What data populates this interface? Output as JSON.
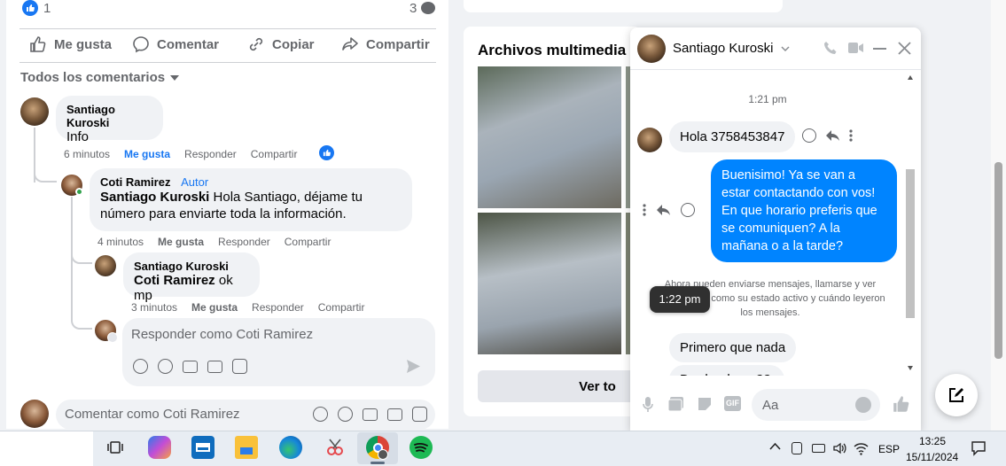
{
  "post": {
    "like_count": "1",
    "comment_count": "3",
    "actions": {
      "like": "Me gusta",
      "comment": "Comentar",
      "copy": "Copiar",
      "share": "Compartir"
    },
    "comments_filter": "Todos los comentarios"
  },
  "comments": {
    "c1": {
      "author": "Santiago Kuroski",
      "text": "Info",
      "time": "6 minutos",
      "like": "Me gusta",
      "reply": "Responder",
      "share": "Compartir"
    },
    "c2": {
      "author": "Coti Ramirez",
      "badge": "Autor",
      "mention": "Santiago Kuroski",
      "text": " Hola Santiago, déjame tu número para enviarte toda la información.",
      "time": "4 minutos",
      "like": "Me gusta",
      "reply": "Responder",
      "share": "Compartir"
    },
    "c3": {
      "author": "Santiago Kuroski",
      "mention": "Coti Ramirez",
      "text": " ok mp",
      "time": "3 minutos",
      "like": "Me gusta",
      "reply": "Responder",
      "share": "Compartir"
    },
    "reply_placeholder": "Responder como Coti Ramirez",
    "comment_placeholder": "Comentar como Coti Ramirez"
  },
  "media": {
    "title": "Archivos multimedia re",
    "see_all": "Ver to"
  },
  "chat": {
    "contact": "Santiago Kuroski",
    "time_sep": "1:21 pm",
    "msg_in_1": "Hola 3758453847",
    "msg_out_1": "Buenisimo! Ya se van a estar contactando con vos! En que horario preferis que se comuniquen? A la mañana o a la tarde?",
    "notice": "Ahora pueden enviarse mensajes, llamarse y ver información, como su estado activo y cuándo leyeron los mensajes.",
    "tooltip": "1:22 pm",
    "msg_in_2": "Primero que nada",
    "msg_in_3": "De donde ....??",
    "input_placeholder": "Aa"
  },
  "taskbar": {
    "lang": "ESP",
    "time": "13:25",
    "date": "15/11/2024"
  },
  "colors": {
    "messenger_blue": "#0084ff",
    "fb_blue": "#1877f2",
    "spotify": "#1db954"
  }
}
